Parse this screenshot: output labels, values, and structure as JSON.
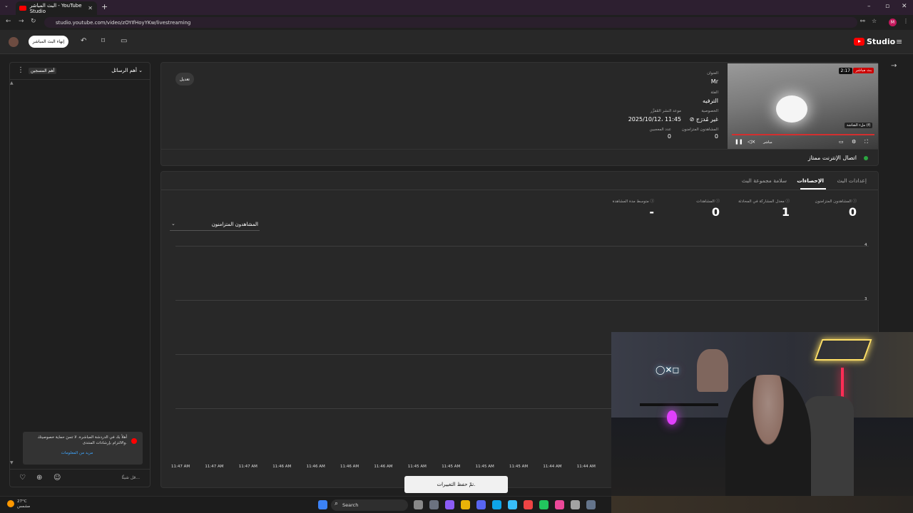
{
  "browser": {
    "tab_title": "البث المباشر - YouTube Studio",
    "url": "studio.youtube.com/video/zOYIfHoyYKw/livestreaming"
  },
  "header": {
    "end_stream_label": "إنهاء البث المباشر",
    "logo_text": "Studio"
  },
  "chat": {
    "title": "أهم الرسائل",
    "pin_label": "أهم المسجين",
    "notice_text": "أهلاً بك في الدردشة المباشرة. لا تنسَ حماية خصوصيتك والالتزام بإرشادات المنتدى.",
    "notice_link": "مزيد من المعلومات",
    "input_placeholder": "قل شيئًا..."
  },
  "stream_info": {
    "edit_label": "تعديل",
    "title_label": "العنوان",
    "title_value": "Mr",
    "category_label": "الفئة",
    "category_value": "الترفيه",
    "privacy_label": "الخصوصية",
    "privacy_value": "غير مُدرَج",
    "schedule_label": "موعد النشر المُقرَّر",
    "schedule_value": "2025/10/12، 11:45",
    "concurrent_label": "المشاهدون المتزامنون",
    "concurrent_value": "0",
    "likes_label": "عدد المعجبين",
    "likes_value": "0",
    "preview_live_badge": "بث مباشر",
    "preview_time": "2:17",
    "preview_tooltip": "ملء الشاشة (f)",
    "preview_quality": "مباشر",
    "connection_status": "اتصال الإنترنت ممتاز",
    "connection_color": "#2ba640"
  },
  "stats": {
    "tabs": [
      {
        "label": "إعدادات البث"
      },
      {
        "label": "الإحصاءات"
      },
      {
        "label": "سلامة مجموعة البث"
      }
    ],
    "active_tab": "الإحصاءات",
    "metrics": [
      {
        "label": "المشاهدون المتزامنون",
        "value": "0"
      },
      {
        "label": "معدل المشاركة في المحادثة",
        "value": "1"
      },
      {
        "label": "المشاهدات",
        "value": "0"
      },
      {
        "label": "متوسط مدة المشاهدة",
        "value": "-"
      }
    ],
    "dropdown_label": "المشاهدون المتزامنون"
  },
  "chart_data": {
    "type": "line",
    "x": [
      "11:47 AM",
      "11:47 AM",
      "11:47 AM",
      "11:46 AM",
      "11:46 AM",
      "11:46 AM",
      "11:46 AM",
      "11:45 AM",
      "11:45 AM",
      "11:45 AM",
      "11:45 AM",
      "11:44 AM",
      "11:44 AM"
    ],
    "y_ticks": [
      "4",
      "3"
    ],
    "series": [],
    "grid": true
  },
  "toast": {
    "text": "تمّ حفظ التغييرات."
  },
  "taskbar": {
    "weather_temp": "27°C",
    "weather_desc": "مشمس",
    "search_label": "Search",
    "icons": [
      "windows-start-icon",
      "search-icon",
      "weather-widget",
      "task-view-icon",
      "copilot-icon",
      "file-explorer-icon",
      "discord-icon",
      "edge-icon",
      "store-icon",
      "chrome-icon",
      "browser-icon",
      "tiktok-icon",
      "app-icon",
      "terminal-icon",
      "capture-icon"
    ]
  }
}
